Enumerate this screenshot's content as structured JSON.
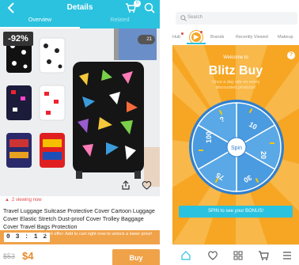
{
  "left_screen": {
    "header": {
      "title": "Details",
      "cart_count": "0",
      "tabs": [
        {
          "label": "Overview",
          "active": true
        },
        {
          "label": "Related",
          "active": false
        }
      ]
    },
    "image": {
      "discount_badge": "-92%",
      "photo_count": "21"
    },
    "viewing_now": "2 viewing now",
    "product_title": "Travel Luggage Suitcase Protective Cover Cartoon Luggage Cover Elastic Stretch Dust-proof Cover Trolley Baggage Cover Travel Bags Protection",
    "timer": "0 3 : 1 2",
    "offer_text": "Instant offer: Add to cart right now to unlock a lower price!",
    "price": {
      "original": "$53",
      "sale": "$4"
    },
    "buy_label": "Buy",
    "colors": {
      "header": "#2bc2df",
      "accent": "#f0a249"
    }
  },
  "right_screen": {
    "search_placeholder": "Search",
    "tabs": [
      "Hub",
      "Brands",
      "Recently Viewed",
      "Makeup"
    ],
    "blitz": {
      "welcome": "Welcome to",
      "title": "Blitz Buy",
      "subtitle": "Once a day site on every discounted products!",
      "wheel_values": [
        "10",
        "20",
        "30",
        "75",
        "100",
        "?"
      ],
      "spin_center": "Spin",
      "spin_cta": "SPIN to see your BONUS!"
    },
    "bottom_nav": [
      "home-icon",
      "heart-icon",
      "categories-icon",
      "cart-icon",
      "menu-icon"
    ],
    "colors": {
      "background": "#f6a623",
      "wheel": "#3f8ed6",
      "cta": "#2bc2df"
    }
  }
}
